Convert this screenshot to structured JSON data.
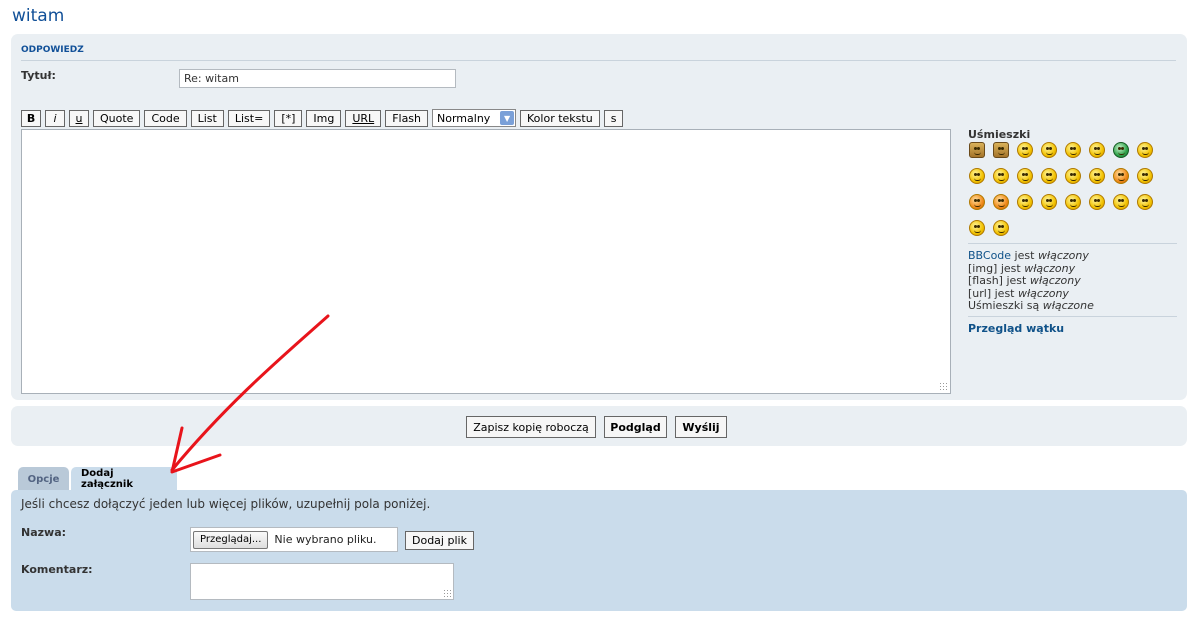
{
  "page": {
    "title": "witam"
  },
  "reply": {
    "header": "ODPOWIEDZ",
    "subject_label": "Tytuł:",
    "subject_value": "Re: witam"
  },
  "toolbar": {
    "buttons": [
      "B",
      "i",
      "u",
      "Quote",
      "Code",
      "List",
      "List=",
      "[*]",
      "Img",
      "URL",
      "Flash"
    ],
    "font_size_selected": "Normalny",
    "color_button": "Kolor tekstu",
    "s_button": "s"
  },
  "smilies": {
    "title": "Uśmieszki",
    "icons": [
      "thumbs-up-smiley-icon",
      "thumbs-down-smiley-icon",
      "laughing-smiley-icon",
      "grin-smiley-icon",
      "wink-smiley-icon",
      "confused-smiley-icon",
      "green-mad-smiley-icon",
      "shocked-smiley-icon",
      "surprised-smiley-icon",
      "eek-smiley-icon",
      "cool-smiley-icon",
      "tongue-smiley-icon",
      "lol-smiley-icon",
      "happy-smiley-icon",
      "angry-smiley-icon",
      "neutral-smiley-icon",
      "evil-smiley-icon",
      "twisted-smiley-icon",
      "rolleyes-smiley-icon",
      "exclamation-smiley-icon",
      "question-smiley-icon",
      "idea-smiley-icon",
      "arrow-smiley-icon",
      "sad-smiley-icon",
      "geek-smiley-icon",
      "uber-geek-smiley-icon"
    ]
  },
  "status": {
    "bbcode_link": "BBCode",
    "bbcode_text": " jest ",
    "bbcode_state": "włączony",
    "img_text": "[img] jest ",
    "img_state": "włączony",
    "flash_text": "[flash] jest ",
    "flash_state": "włączony",
    "url_text": "[url] jest ",
    "url_state": "włączony",
    "smilies_text": "Uśmieszki są ",
    "smilies_state": "włączone"
  },
  "topic_review": "Przegląd wątku",
  "actions": {
    "save_draft": "Zapisz kopię roboczą",
    "preview": "Podgląd",
    "submit": "Wyślij"
  },
  "tabs": [
    "Opcje",
    "Dodaj załącznik"
  ],
  "attachment": {
    "description": "Jeśli chcesz dołączyć jeden lub więcej plików, uzupełnij pola poniżej.",
    "name_label": "Nazwa:",
    "browse_button": "Przeglądaj...",
    "no_file_text": "Nie wybrano pliku.",
    "add_file_button": "Dodaj plik",
    "comment_label": "Komentarz:"
  },
  "colors": {
    "accent": "#115098",
    "panel_bg": "#eaeff3",
    "attach_bg": "#cadceb",
    "annotation_arrow": "#e8141b"
  }
}
